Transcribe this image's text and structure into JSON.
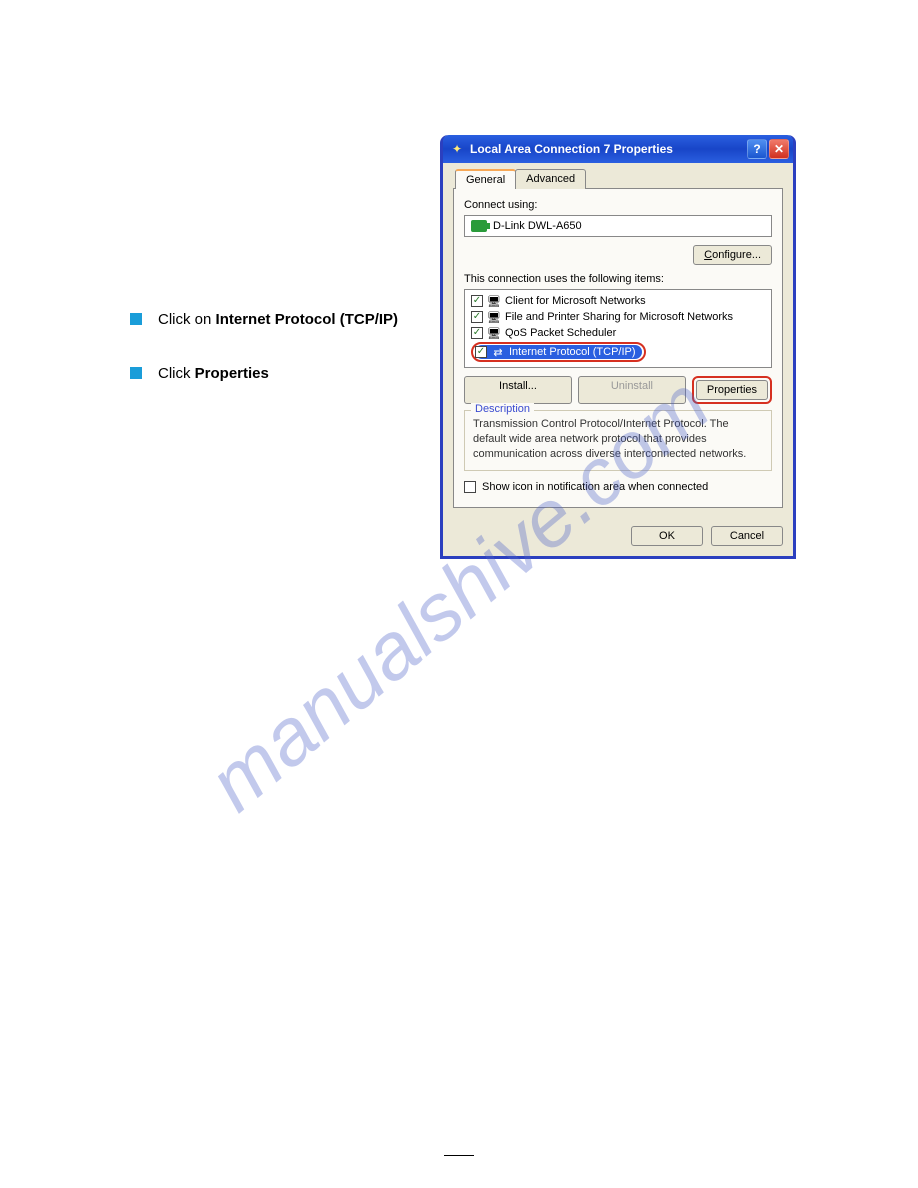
{
  "watermark": "manualshive.com",
  "instructions": {
    "item1_prefix": "Click on ",
    "item1_bold": "Internet Protocol (TCP/IP)",
    "item2_prefix": "Click ",
    "item2_bold": "Properties"
  },
  "window": {
    "title": "Local Area Connection 7 Properties",
    "tabs": {
      "general": "General",
      "advanced": "Advanced"
    },
    "connect_using_label": "Connect using:",
    "device_name": "D-Link DWL-A650",
    "configure_btn": "Configure...",
    "items_label": "This connection uses the following items:",
    "items": {
      "client": "Client for Microsoft Networks",
      "fps": "File and Printer Sharing for Microsoft Networks",
      "qos": "QoS Packet Scheduler",
      "tcpip": "Internet Protocol (TCP/IP)"
    },
    "install_btn": "Install...",
    "uninstall_btn": "Uninstall",
    "properties_btn": "Properties",
    "desc_title": "Description",
    "desc_text": "Transmission Control Protocol/Internet Protocol. The default wide area network protocol that provides communication across diverse interconnected networks.",
    "show_icon_label": "Show icon in notification area when connected",
    "ok_btn": "OK",
    "cancel_btn": "Cancel"
  },
  "page_number": ""
}
